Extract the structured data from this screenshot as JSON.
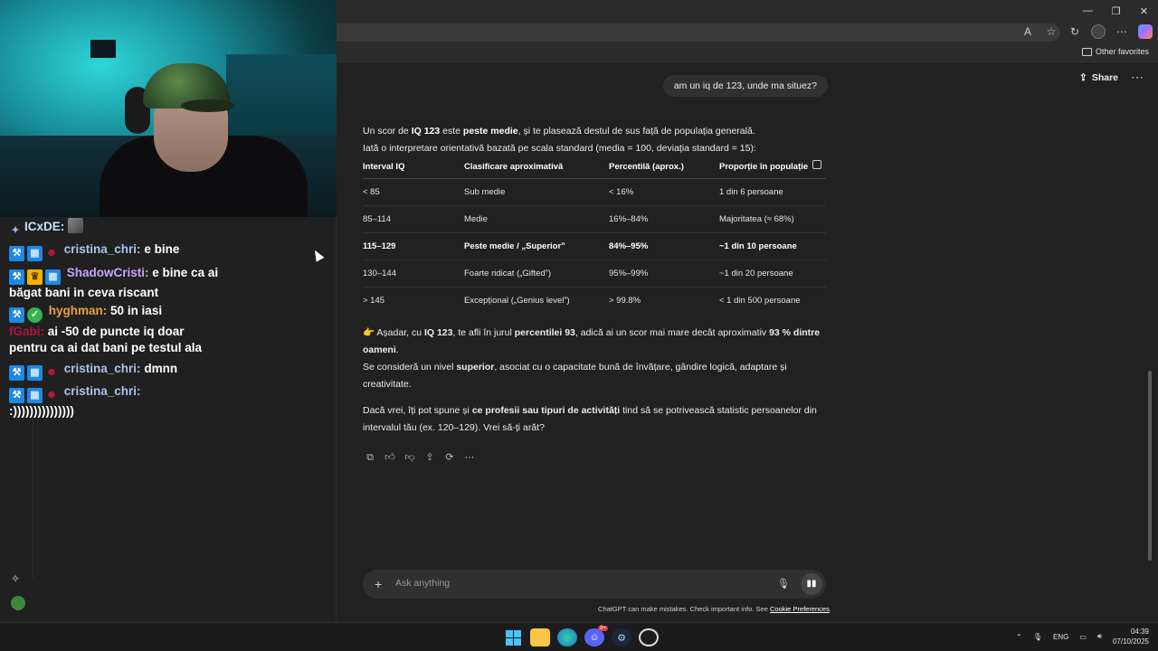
{
  "browser": {
    "favorites_label": "Other favorites",
    "window_controls": [
      "—",
      "❐",
      "✕"
    ]
  },
  "chat": {
    "messages": [
      {
        "user": "ICxDE:",
        "text": ""
      },
      {
        "user": "cristina_chri:",
        "text": "e bine"
      },
      {
        "user": "ShadowCristi:",
        "text": "e bine ca ai băgat bani in ceva riscant"
      },
      {
        "user": "hyghman:",
        "text": "50 in iasi"
      },
      {
        "user": "fGabi:",
        "text": "ai -50 de puncte iq doar pentru ca ai dat bani pe testul ala"
      },
      {
        "user": "cristina_chri:",
        "text": "dmnn"
      },
      {
        "user": "cristina_chri:",
        "text": ":)))))))))))))))"
      }
    ]
  },
  "conversation": {
    "share_label": "Share",
    "user_message": "am un iq de 123, unde ma situez?",
    "answer_intro": {
      "t1": "Un scor de ",
      "b1": "IQ 123",
      "t2": " este ",
      "b2": "peste medie",
      "t3": ", și te plasează destul de sus față de populația generală.",
      "line2": "Iată o interpretare orientativă bazată pe scala standard (media = 100, deviația standard = 15):"
    },
    "table": {
      "headers": [
        "Interval IQ",
        "Clasificare aproximativă",
        "Percentilă (aprox.)",
        "Proporție în populație"
      ],
      "rows": [
        [
          "< 85",
          "Sub medie",
          "< 16%",
          "1 din 6 persoane"
        ],
        [
          "85–114",
          "Medie",
          "16%–84%",
          "Majoritatea (≈ 68%)"
        ],
        [
          "115–129",
          "Peste medie / „Superior”",
          "84%–95%",
          "~1 din 10 persoane"
        ],
        [
          "130–144",
          "Foarte ridicat („Gifted”)",
          "95%–99%",
          "~1 din 20 persoane"
        ],
        [
          "> 145",
          "Excepțional („Genius level”)",
          "> 99.8%",
          "< 1 din 500 persoane"
        ]
      ]
    },
    "summary": {
      "emoji": "👉",
      "t1": " Așadar, cu ",
      "b1": "IQ 123",
      "t2": ", te afli în jurul ",
      "b2": "percentilei 93",
      "t3": ", adică ai un scor mai mare decât aproximativ ",
      "b3": "93 % dintre oameni",
      "t4": ".",
      "l2a": "Se consideră un nivel ",
      "l2b": "superior",
      "l2c": ", asociat cu o capacitate bună de învățare, gândire logică, adaptare și creativitate."
    },
    "followup": {
      "t1": "Dacă vrei, îți pot spune și ",
      "b1": "ce profesii sau tipuri de activități",
      "t2": " tind să se potrivească statistic persoanelor din intervalul tău (ex. 120–129). Vrei să-ți arăt?"
    },
    "composer_placeholder": "Ask anything",
    "disclaimer": "ChatGPT can make mistakes. Check important info. See ",
    "disclaimer_link": "Cookie Preferences",
    "disclaimer_end": "."
  },
  "taskbar": {
    "language": "ENG",
    "time": "04:39",
    "date": "07/10/2025",
    "discord_badge": "9+"
  }
}
